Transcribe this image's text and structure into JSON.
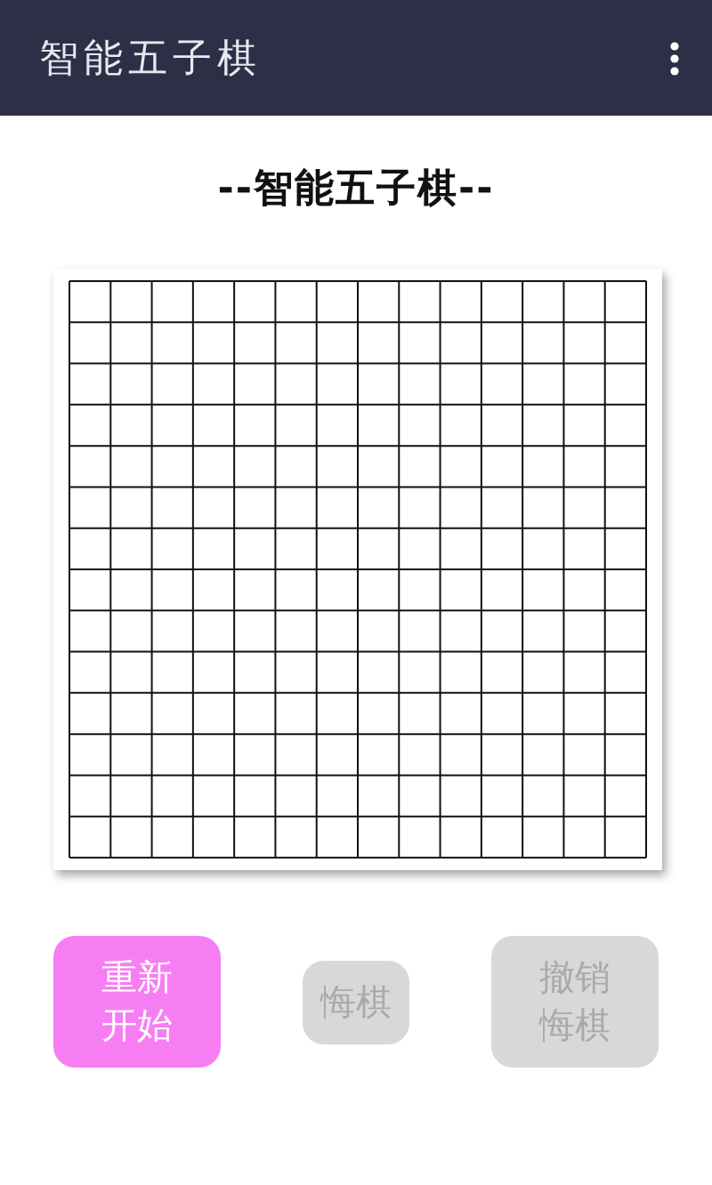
{
  "app_bar": {
    "title": "智能五子棋"
  },
  "heading": "--智能五子棋--",
  "buttons": [
    {
      "label": "重新开始",
      "disabled": false
    },
    {
      "label": "悔棋",
      "disabled": true
    },
    {
      "label": "撤销悔棋",
      "disabled": true
    }
  ]
}
